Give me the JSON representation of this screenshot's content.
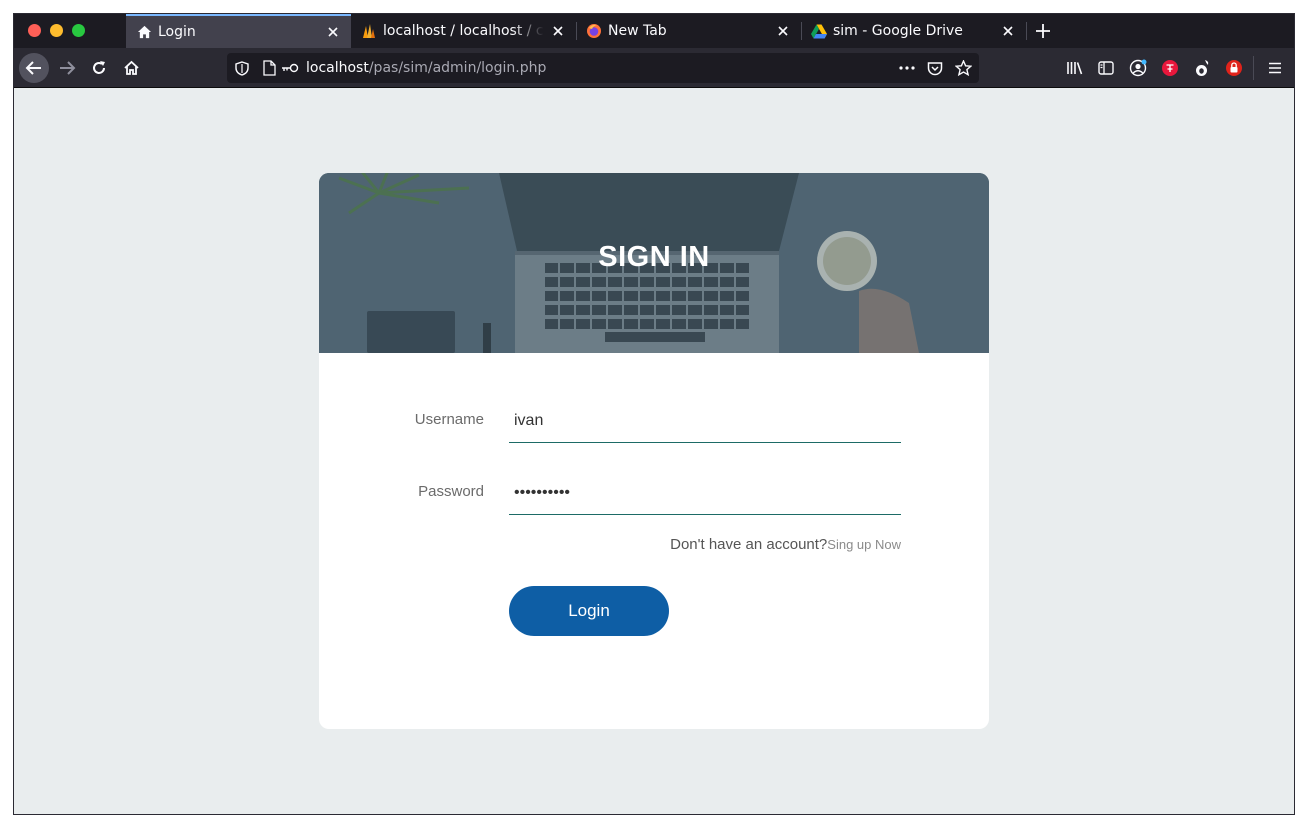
{
  "browser": {
    "tabs": [
      {
        "title": "Login",
        "active": true,
        "icon": "home-icon"
      },
      {
        "title": "localhost / localhost / cru",
        "active": false,
        "icon": "phpmyadmin-icon"
      },
      {
        "title": "New Tab",
        "active": false,
        "icon": "firefox-icon"
      },
      {
        "title": "sim - Google Drive",
        "active": false,
        "icon": "google-drive-icon"
      }
    ],
    "url": {
      "host": "localhost",
      "path": "/pas/sim/admin/login.php"
    },
    "colors": {
      "titlebar": "#1c1b22",
      "toolbar": "#2b2a33",
      "active_tab_accent": "#7ab8ff"
    }
  },
  "login": {
    "title": "SIGN IN",
    "username_label": "Username",
    "username_value": "ivan",
    "password_label": "Password",
    "password_value": "••••••••••",
    "signup_prompt": "Don't have an account?",
    "signup_link": "Sing up Now",
    "login_button": "Login",
    "colors": {
      "page_bg": "#e9edee",
      "button": "#0e5ea5",
      "input_underline": "#1d6b66"
    }
  }
}
